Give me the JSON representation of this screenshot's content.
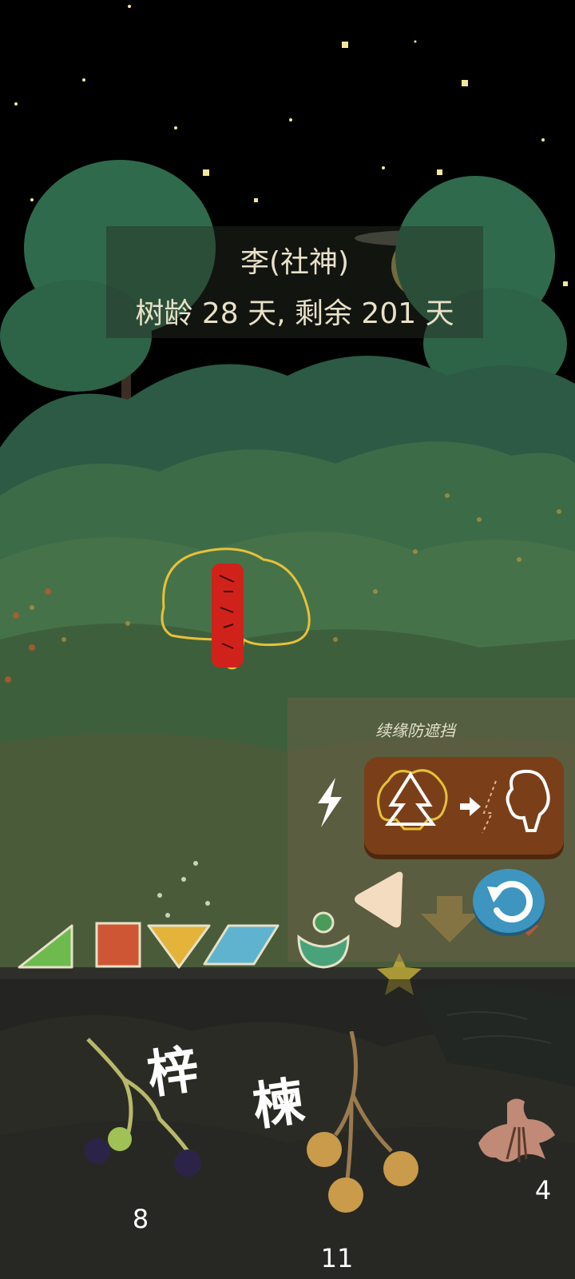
{
  "tree_info": {
    "name": "李(社神)",
    "age": "树龄 28 天, 剩余 201 天"
  },
  "panel": {
    "title": "续缘防遮挡"
  },
  "seeds": [
    {
      "name": "梓",
      "count": "8"
    },
    {
      "name": "楝",
      "count": "11"
    },
    {
      "name": "",
      "count": "4"
    }
  ],
  "colors": {
    "sky": "#000000",
    "forest_dark": "#2c4a34",
    "forest_light": "#4f7c4e",
    "tag_red": "#d0221b",
    "highlight_yellow": "#e6c13a",
    "swap_button": "#7a3f19",
    "reset_button": "#3d95c0"
  },
  "icons": {
    "bolt": "lightning-icon",
    "swap": "tree-swap-icon",
    "reset": "undo-icon",
    "left": "triangle-left-icon",
    "down": "arrow-down-icon",
    "close": "close-icon"
  }
}
